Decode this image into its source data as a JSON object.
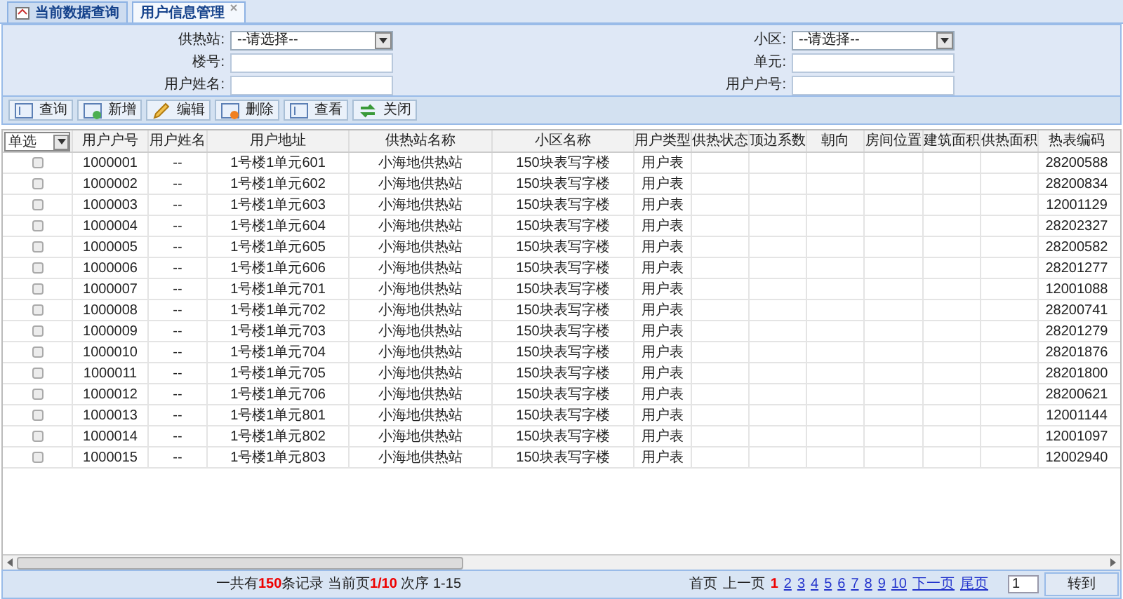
{
  "tabs": [
    {
      "label": "当前数据查询",
      "selected": false,
      "closable": false
    },
    {
      "label": "用户信息管理",
      "selected": true,
      "closable": true
    }
  ],
  "filters": {
    "left": [
      {
        "label": "供热站:",
        "kind": "select",
        "value": "--请选择--"
      },
      {
        "label": "楼号:",
        "kind": "text"
      },
      {
        "label": "用户姓名:",
        "kind": "text"
      }
    ],
    "right": [
      {
        "label": "小区:",
        "kind": "select",
        "value": "--请选择--"
      },
      {
        "label": "单元:",
        "kind": "text"
      },
      {
        "label": "用户户号:",
        "kind": "text"
      }
    ]
  },
  "toolbar": [
    {
      "label": "查询",
      "kind": "grid"
    },
    {
      "label": "新增",
      "kind": "add"
    },
    {
      "label": "编辑",
      "kind": "edit"
    },
    {
      "label": "删除",
      "kind": "delete"
    },
    {
      "label": "查看",
      "kind": "grid"
    },
    {
      "label": "关闭",
      "kind": "refresh"
    }
  ],
  "table": {
    "select_mode": "单选",
    "columns": [
      "用户户号",
      "用户姓名",
      "用户地址",
      "供热站名称",
      "小区名称",
      "用户类型",
      "供热状态",
      "顶边系数",
      "朝向",
      "房间位置",
      "建筑面积",
      "供热面积",
      "热表编码"
    ],
    "rows": [
      {
        "checked": false,
        "cells": [
          "1000001",
          "--",
          "1号楼1单元601",
          "小海地供热站",
          "150块表写字楼",
          "用户表",
          "",
          "",
          "",
          "",
          "",
          "",
          "28200588"
        ]
      },
      {
        "checked": false,
        "cells": [
          "1000002",
          "--",
          "1号楼1单元602",
          "小海地供热站",
          "150块表写字楼",
          "用户表",
          "",
          "",
          "",
          "",
          "",
          "",
          "28200834"
        ]
      },
      {
        "checked": false,
        "cells": [
          "1000003",
          "--",
          "1号楼1单元603",
          "小海地供热站",
          "150块表写字楼",
          "用户表",
          "",
          "",
          "",
          "",
          "",
          "",
          "12001129"
        ]
      },
      {
        "checked": false,
        "cells": [
          "1000004",
          "--",
          "1号楼1单元604",
          "小海地供热站",
          "150块表写字楼",
          "用户表",
          "",
          "",
          "",
          "",
          "",
          "",
          "28202327"
        ]
      },
      {
        "checked": false,
        "cells": [
          "1000005",
          "--",
          "1号楼1单元605",
          "小海地供热站",
          "150块表写字楼",
          "用户表",
          "",
          "",
          "",
          "",
          "",
          "",
          "28200582"
        ]
      },
      {
        "checked": false,
        "cells": [
          "1000006",
          "--",
          "1号楼1单元606",
          "小海地供热站",
          "150块表写字楼",
          "用户表",
          "",
          "",
          "",
          "",
          "",
          "",
          "28201277"
        ]
      },
      {
        "checked": false,
        "cells": [
          "1000007",
          "--",
          "1号楼1单元701",
          "小海地供热站",
          "150块表写字楼",
          "用户表",
          "",
          "",
          "",
          "",
          "",
          "",
          "12001088"
        ]
      },
      {
        "checked": false,
        "cells": [
          "1000008",
          "--",
          "1号楼1单元702",
          "小海地供热站",
          "150块表写字楼",
          "用户表",
          "",
          "",
          "",
          "",
          "",
          "",
          "28200741"
        ]
      },
      {
        "checked": false,
        "cells": [
          "1000009",
          "--",
          "1号楼1单元703",
          "小海地供热站",
          "150块表写字楼",
          "用户表",
          "",
          "",
          "",
          "",
          "",
          "",
          "28201279"
        ]
      },
      {
        "checked": false,
        "cells": [
          "1000010",
          "--",
          "1号楼1单元704",
          "小海地供热站",
          "150块表写字楼",
          "用户表",
          "",
          "",
          "",
          "",
          "",
          "",
          "28201876"
        ]
      },
      {
        "checked": false,
        "cells": [
          "1000011",
          "--",
          "1号楼1单元705",
          "小海地供热站",
          "150块表写字楼",
          "用户表",
          "",
          "",
          "",
          "",
          "",
          "",
          "28201800"
        ]
      },
      {
        "checked": false,
        "cells": [
          "1000012",
          "--",
          "1号楼1单元706",
          "小海地供热站",
          "150块表写字楼",
          "用户表",
          "",
          "",
          "",
          "",
          "",
          "",
          "28200621"
        ]
      },
      {
        "checked": false,
        "cells": [
          "1000013",
          "--",
          "1号楼1单元801",
          "小海地供热站",
          "150块表写字楼",
          "用户表",
          "",
          "",
          "",
          "",
          "",
          "",
          "12001144"
        ]
      },
      {
        "checked": false,
        "cells": [
          "1000014",
          "--",
          "1号楼1单元802",
          "小海地供热站",
          "150块表写字楼",
          "用户表",
          "",
          "",
          "",
          "",
          "",
          "",
          "12001097"
        ]
      },
      {
        "checked": false,
        "cells": [
          "1000015",
          "--",
          "1号楼1单元803",
          "小海地供热站",
          "150块表写字楼",
          "用户表",
          "",
          "",
          "",
          "",
          "",
          "",
          "12002940"
        ]
      }
    ]
  },
  "footer": {
    "summary": "一共有**150**条记录 当前页**1/10** 次序 1-15",
    "pager": [
      {
        "label": "首页",
        "kind": "plain",
        "selected": false
      },
      {
        "label": "上一页",
        "kind": "plain",
        "selected": false
      },
      {
        "label": "1",
        "kind": "page",
        "selected": true
      },
      {
        "label": "2",
        "kind": "page",
        "selected": false
      },
      {
        "label": "3",
        "kind": "page",
        "selected": false
      },
      {
        "label": "4",
        "kind": "page",
        "selected": false
      },
      {
        "label": "5",
        "kind": "page",
        "selected": false
      },
      {
        "label": "6",
        "kind": "page",
        "selected": false
      },
      {
        "label": "7",
        "kind": "page",
        "selected": false
      },
      {
        "label": "8",
        "kind": "page",
        "selected": false
      },
      {
        "label": "9",
        "kind": "page",
        "selected": false
      },
      {
        "label": "10",
        "kind": "page",
        "selected": false
      },
      {
        "label": "下一页",
        "kind": "link",
        "selected": false
      },
      {
        "label": "尾页",
        "kind": "link",
        "selected": false
      }
    ],
    "page_input": "1",
    "go_button": "转到"
  }
}
